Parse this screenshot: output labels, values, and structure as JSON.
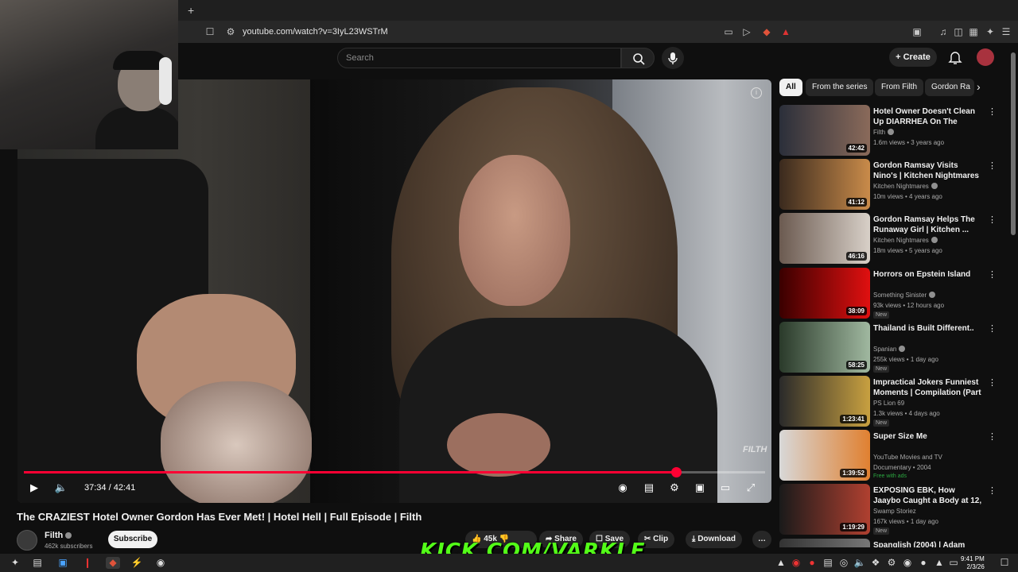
{
  "browser": {
    "new_tab_label": "+",
    "url": "youtube.com/watch?v=3IyL23WSTrM"
  },
  "header": {
    "search_placeholder": "Search",
    "create_label": "Create"
  },
  "player": {
    "current_time": "37:34",
    "duration": "42:41",
    "time_display": "37:34 / 42:41",
    "progress": 0.88,
    "watermark": "FILTH",
    "accent": "#ff0033"
  },
  "video": {
    "title": "The CRAZIEST Hotel Owner Gordon Has Ever Met! | Hotel Hell | Full Episode | Filth",
    "channel": "Filth",
    "subscribers": "462k subscribers",
    "subscribe_label": "Subscribe",
    "likes": "45k",
    "share_label": "Share",
    "save_label": "Save",
    "clip_label": "Clip",
    "download_label": "Download"
  },
  "overlay": {
    "kick_text": "KICK.COM/VARKLE",
    "brand_color": "#53fc18"
  },
  "chips": [
    {
      "label": "All",
      "active": true
    },
    {
      "label": "From the series",
      "active": false
    },
    {
      "label": "From Filth",
      "active": false
    },
    {
      "label": "Gordon Ra",
      "active": false
    }
  ],
  "recommendations": [
    {
      "title": "Hotel Owner Doesn't Clean Up DIARRHEA On The Carpet | ...",
      "channel": "Filth",
      "meta": "1.6m views • 3 years ago",
      "duration": "42:42",
      "badge": ""
    },
    {
      "title": "Gordon Ramsay Visits Nino's | Kitchen Nightmares FULL ...",
      "channel": "Kitchen Nightmares",
      "meta": "10m views • 4 years ago",
      "duration": "41:12",
      "badge": ""
    },
    {
      "title": "Gordon Ramsay Helps The Runaway Girl | Kitchen ...",
      "channel": "Kitchen Nightmares",
      "meta": "18m views • 5 years ago",
      "duration": "46:16",
      "badge": ""
    },
    {
      "title": "Horrors on Epstein Island",
      "channel": "Something Sinister",
      "meta": "93k views • 12 hours ago",
      "duration": "38:09",
      "badge": "New"
    },
    {
      "title": "Thailand is Built Different..",
      "channel": "Spanian",
      "meta": "255k views • 1 day ago",
      "duration": "58:25",
      "badge": "New"
    },
    {
      "title": "Impractical Jokers Funniest Moments | Compilation (Part ...",
      "channel": "PS Lion 69",
      "meta": "1.3k views • 4 days ago",
      "duration": "1:23:41",
      "badge": "New"
    },
    {
      "title": "Super Size Me",
      "channel": "YouTube Movies and TV",
      "meta": "Documentary • 2004",
      "duration": "1:39:52",
      "badge": "Free with ads"
    },
    {
      "title": "EXPOSING EBK, How Jaaybo Caught a Body at 12, ...",
      "channel": "Swamp Storiez",
      "meta": "167k views • 1 day ago",
      "duration": "1:19:29",
      "badge": "New"
    },
    {
      "title": "Spanglish (2004) | Adam",
      "channel": "",
      "meta": "",
      "duration": "",
      "badge": ""
    }
  ],
  "taskbar": {
    "time": "9:41 PM",
    "date": "2/3/26"
  }
}
